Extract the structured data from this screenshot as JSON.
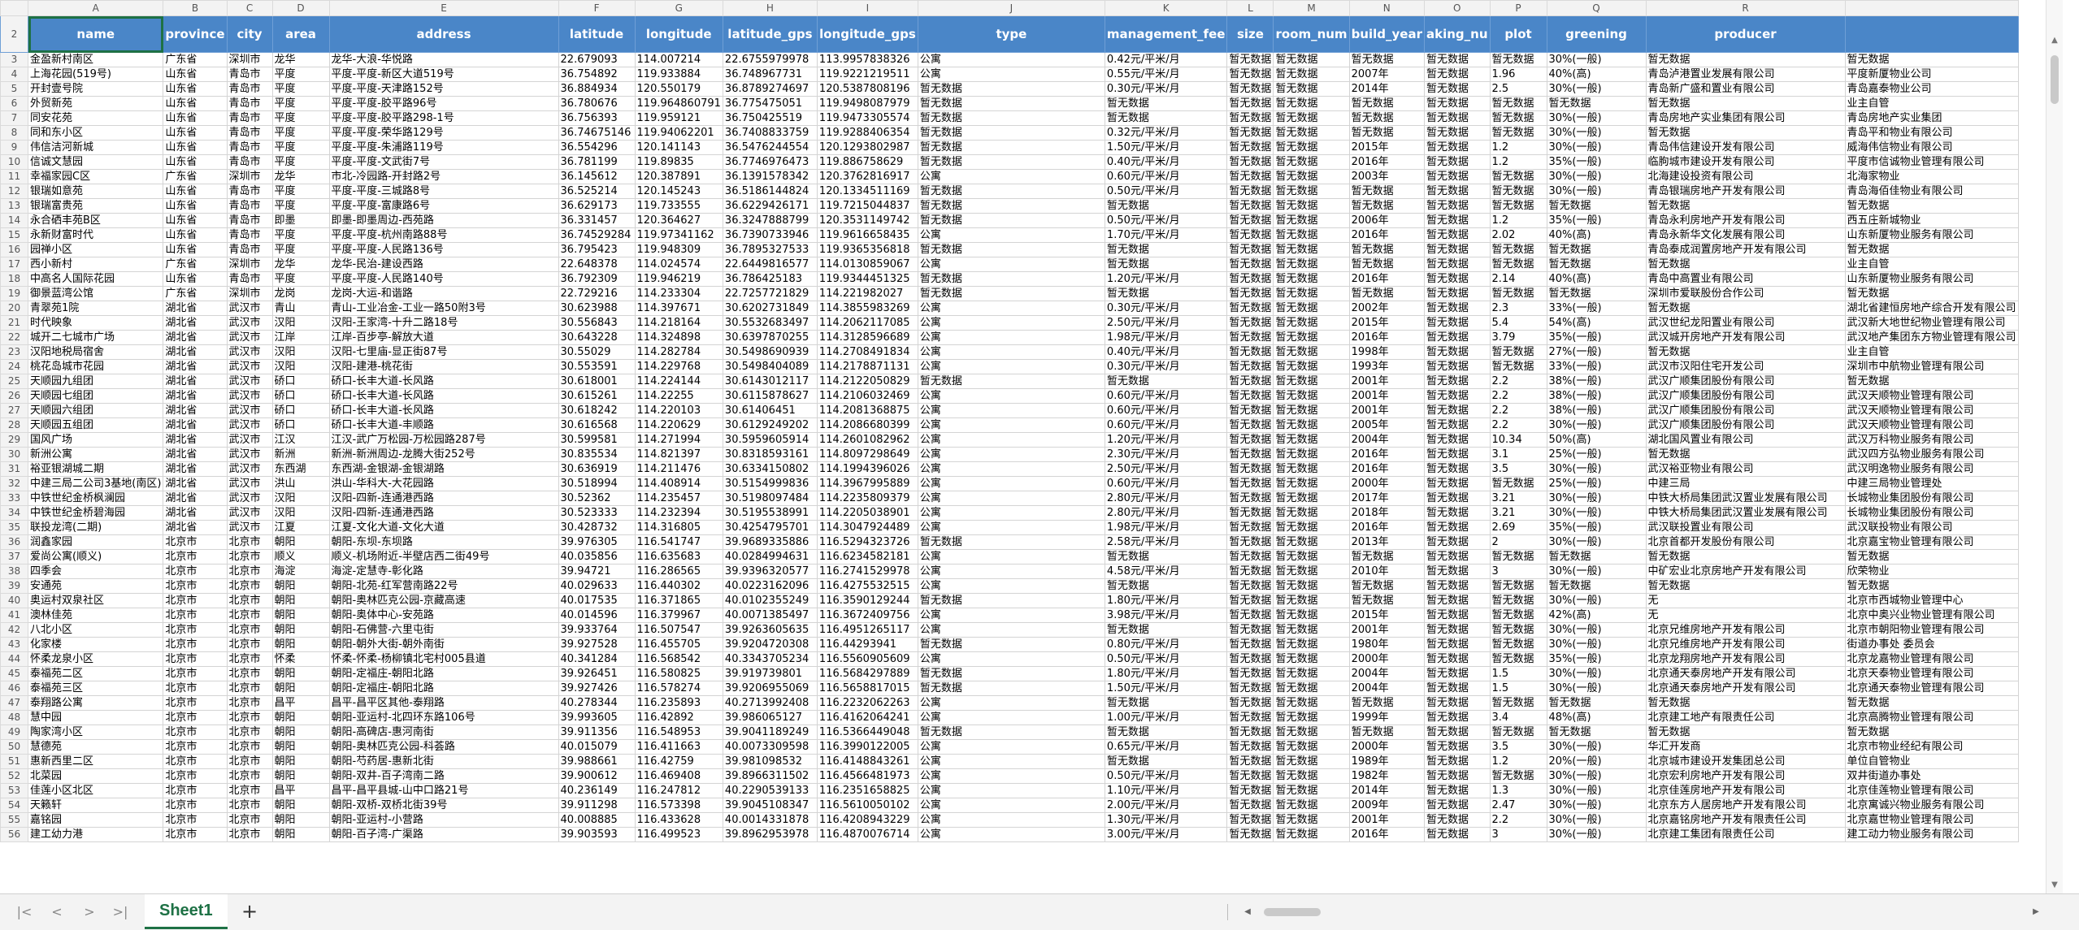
{
  "columns": [
    "A",
    "B",
    "C",
    "D",
    "E",
    "F",
    "G",
    "H",
    "I",
    "J",
    "K",
    "L",
    "M",
    "N",
    "O",
    "P",
    "Q",
    "R"
  ],
  "header_row_number": "2",
  "fields": [
    "name",
    "province",
    "city",
    "area",
    "address",
    "latitude",
    "longitude",
    "latitude_gps",
    "longitude_gps",
    "type",
    "management_fee",
    "size",
    "room_num",
    "build_year",
    "aking_nu",
    "plot",
    "greening",
    "producer"
  ],
  "rows": [
    [
      "3",
      "金盈新村南区",
      "广东省",
      "深圳市",
      "龙华",
      "龙华-大浪-华悦路",
      "22.679093",
      "114.007214",
      "22.6755979978",
      "113.9957838326",
      "公寓",
      "0.42元/平米/月",
      "暂无数据",
      "暂无数据",
      "暂无数据",
      "暂无数据",
      "暂无数据",
      "30%(一般)",
      "暂无数据",
      "暂无数据"
    ],
    [
      "4",
      "上海花园(519号)",
      "山东省",
      "青岛市",
      "平度",
      "平度-平度-新区大道519号",
      "36.754892",
      "119.933884",
      "36.748967731",
      "119.9221219511",
      "公寓",
      "0.55元/平米/月",
      "暂无数据",
      "暂无数据",
      "2007年",
      "暂无数据",
      "1.96",
      "40%(高)",
      "青岛泸港置业发展有限公司",
      "平度新厦物业公司"
    ],
    [
      "5",
      "开封壹号院",
      "山东省",
      "青岛市",
      "平度",
      "平度-平度-天津路152号",
      "36.884934",
      "120.550179",
      "36.8789274697",
      "120.5387808196",
      "暂无数据",
      "0.30元/平米/月",
      "暂无数据",
      "暂无数据",
      "2014年",
      "暂无数据",
      "2.5",
      "30%(一般)",
      "青岛新广盛和置业有限公司",
      "青岛嘉泰物业公司"
    ],
    [
      "6",
      "外贸新苑",
      "山东省",
      "青岛市",
      "平度",
      "平度-平度-胶平路96号",
      "36.780676",
      "119.964860791",
      "36.775475051",
      "119.9498087979",
      "暂无数据",
      "暂无数据",
      "暂无数据",
      "暂无数据",
      "暂无数据",
      "暂无数据",
      "暂无数据",
      "暂无数据",
      "暂无数据",
      "业主自管"
    ],
    [
      "7",
      "同安花苑",
      "山东省",
      "青岛市",
      "平度",
      "平度-平度-胶平路298-1号",
      "36.756393",
      "119.959121",
      "36.750425519",
      "119.9473305574",
      "暂无数据",
      "暂无数据",
      "暂无数据",
      "暂无数据",
      "暂无数据",
      "暂无数据",
      "暂无数据",
      "30%(一般)",
      "青岛房地产实业集团有限公司",
      "青岛房地产实业集团"
    ],
    [
      "8",
      "同和东小区",
      "山东省",
      "青岛市",
      "平度",
      "平度-平度-荣华路129号",
      "36.74675146",
      "119.94062201",
      "36.7408833759",
      "119.9288406354",
      "暂无数据",
      "0.32元/平米/月",
      "暂无数据",
      "暂无数据",
      "暂无数据",
      "暂无数据",
      "暂无数据",
      "30%(一般)",
      "暂无数据",
      "青岛平和物业有限公司"
    ],
    [
      "9",
      "伟信洁河新城",
      "山东省",
      "青岛市",
      "平度",
      "平度-平度-朱浦路119号",
      "36.554296",
      "120.141143",
      "36.5476244554",
      "120.1293802987",
      "暂无数据",
      "1.50元/平米/月",
      "暂无数据",
      "暂无数据",
      "2015年",
      "暂无数据",
      "1.2",
      "30%(一般)",
      "青岛伟信建设开发有限公司",
      "威海伟信物业有限公司"
    ],
    [
      "10",
      "信诚文慧园",
      "山东省",
      "青岛市",
      "平度",
      "平度-平度-文武街7号",
      "36.781199",
      "119.89835",
      "36.7746976473",
      "119.886758629",
      "暂无数据",
      "0.40元/平米/月",
      "暂无数据",
      "暂无数据",
      "2016年",
      "暂无数据",
      "1.2",
      "35%(一般)",
      "临朐城市建设开发有限公司",
      "平度市信诚物业管理有限公司"
    ],
    [
      "11",
      "幸福家园C区",
      "广东省",
      "深圳市",
      "龙华",
      "市北-冷园路-开封路2号",
      "36.145612",
      "120.387891",
      "36.1391578342",
      "120.3762816917",
      "公寓",
      "0.60元/平米/月",
      "暂无数据",
      "暂无数据",
      "2003年",
      "暂无数据",
      "暂无数据",
      "30%(一般)",
      "北海建设投资有限公司",
      "北海家物业"
    ],
    [
      "12",
      "银瑞如意苑",
      "山东省",
      "青岛市",
      "平度",
      "平度-平度-三城路8号",
      "36.525214",
      "120.145243",
      "36.5186144824",
      "120.1334511169",
      "暂无数据",
      "0.50元/平米/月",
      "暂无数据",
      "暂无数据",
      "暂无数据",
      "暂无数据",
      "暂无数据",
      "30%(一般)",
      "青岛银瑞房地产开发有限公司",
      "青岛海佰佳物业有限公司"
    ],
    [
      "13",
      "银瑞富贵苑",
      "山东省",
      "青岛市",
      "平度",
      "平度-平度-富康路6号",
      "36.629173",
      "119.733555",
      "36.6229426171",
      "119.7215044837",
      "暂无数据",
      "暂无数据",
      "暂无数据",
      "暂无数据",
      "暂无数据",
      "暂无数据",
      "暂无数据",
      "暂无数据",
      "暂无数据",
      "暂无数据"
    ],
    [
      "14",
      "永合硒丰苑B区",
      "山东省",
      "青岛市",
      "即墨",
      "即墨-即墨周边-西苑路",
      "36.331457",
      "120.364627",
      "36.3247888799",
      "120.3531149742",
      "暂无数据",
      "0.50元/平米/月",
      "暂无数据",
      "暂无数据",
      "2006年",
      "暂无数据",
      "1.2",
      "35%(一般)",
      "青岛永利房地产开发有限公司",
      "西五庄新城物业"
    ],
    [
      "15",
      "永新财富时代",
      "山东省",
      "青岛市",
      "平度",
      "平度-平度-杭州南路88号",
      "36.74529284",
      "119.97341162",
      "36.7390733946",
      "119.9616658435",
      "公寓",
      "1.70元/平米/月",
      "暂无数据",
      "暂无数据",
      "2016年",
      "暂无数据",
      "2.02",
      "40%(高)",
      "青岛永新华文化发展有限公司",
      "山东新厦物业服务有限公司"
    ],
    [
      "16",
      "园禅小区",
      "山东省",
      "青岛市",
      "平度",
      "平度-平度-人民路136号",
      "36.795423",
      "119.948309",
      "36.7895327533",
      "119.9365356818",
      "暂无数据",
      "暂无数据",
      "暂无数据",
      "暂无数据",
      "暂无数据",
      "暂无数据",
      "暂无数据",
      "暂无数据",
      "青岛泰成润置房地产开发有限公司",
      "暂无数据"
    ],
    [
      "17",
      "西小新村",
      "广东省",
      "深圳市",
      "龙华",
      "龙华-民治-建设西路",
      "22.648378",
      "114.024574",
      "22.6449816577",
      "114.0130859067",
      "公寓",
      "暂无数据",
      "暂无数据",
      "暂无数据",
      "暂无数据",
      "暂无数据",
      "暂无数据",
      "暂无数据",
      "暂无数据",
      "业主自管"
    ],
    [
      "18",
      "中高名人国际花园",
      "山东省",
      "青岛市",
      "平度",
      "平度-平度-人民路140号",
      "36.792309",
      "119.946219",
      "36.786425183",
      "119.9344451325",
      "暂无数据",
      "1.20元/平米/月",
      "暂无数据",
      "暂无数据",
      "2016年",
      "暂无数据",
      "2.14",
      "40%(高)",
      "青岛中高置业有限公司",
      "山东新厦物业服务有限公司"
    ],
    [
      "19",
      "御景蓝湾公馆",
      "广东省",
      "深圳市",
      "龙岗",
      "龙岗-大运-和谐路",
      "22.729216",
      "114.233304",
      "22.7257721829",
      "114.221982027",
      "暂无数据",
      "暂无数据",
      "暂无数据",
      "暂无数据",
      "暂无数据",
      "暂无数据",
      "暂无数据",
      "暂无数据",
      "深圳市爱联股份合作公司",
      "暂无数据"
    ],
    [
      "20",
      "青翠苑1院",
      "湖北省",
      "武汉市",
      "青山",
      "青山-工业冶金-工业一路50附3号",
      "30.623988",
      "114.397671",
      "30.6202731849",
      "114.3855983269",
      "公寓",
      "0.30元/平米/月",
      "暂无数据",
      "暂无数据",
      "2002年",
      "暂无数据",
      "2.3",
      "33%(一般)",
      "暂无数据",
      "湖北省建恒房地产综合开发有限公司"
    ],
    [
      "21",
      "时代映象",
      "湖北省",
      "武汉市",
      "汉阳",
      "汉阳-王家湾-十升二路18号",
      "30.556843",
      "114.218164",
      "30.5532683497",
      "114.2062117085",
      "公寓",
      "2.50元/平米/月",
      "暂无数据",
      "暂无数据",
      "2015年",
      "暂无数据",
      "5.4",
      "54%(高)",
      "武汉世纪龙阳置业有限公司",
      "武汉新大地世纪物业管理有限公司"
    ],
    [
      "22",
      "城开二七城市广场",
      "湖北省",
      "武汉市",
      "江岸",
      "江岸-百步亭-解放大道",
      "30.643228",
      "114.324898",
      "30.6397870255",
      "114.3128596689",
      "公寓",
      "1.98元/平米/月",
      "暂无数据",
      "暂无数据",
      "2016年",
      "暂无数据",
      "3.79",
      "35%(一般)",
      "武汉城开房地产开发有限公司",
      "武汉地产集团东方物业管理有限公司"
    ],
    [
      "23",
      "汉阳地税局宿舍",
      "湖北省",
      "武汉市",
      "汉阳",
      "汉阳-七里庙-显正街87号",
      "30.55029",
      "114.282784",
      "30.5498690939",
      "114.2708491834",
      "公寓",
      "0.40元/平米/月",
      "暂无数据",
      "暂无数据",
      "1998年",
      "暂无数据",
      "暂无数据",
      "27%(一般)",
      "暂无数据",
      "业主自管"
    ],
    [
      "24",
      "桃花岛城市花园",
      "湖北省",
      "武汉市",
      "汉阳",
      "汉阳-建港-桃花街",
      "30.553591",
      "114.229768",
      "30.5498404089",
      "114.2178871131",
      "公寓",
      "0.30元/平米/月",
      "暂无数据",
      "暂无数据",
      "1993年",
      "暂无数据",
      "暂无数据",
      "33%(一般)",
      "武汉市汉阳住宅开发公司",
      "深圳市中航物业管理有限公司"
    ],
    [
      "25",
      "天顺园九组团",
      "湖北省",
      "武汉市",
      "硚口",
      "硚口-长丰大道-长风路",
      "30.618001",
      "114.224144",
      "30.6143012117",
      "114.2122050829",
      "暂无数据",
      "暂无数据",
      "暂无数据",
      "暂无数据",
      "2001年",
      "暂无数据",
      "2.2",
      "38%(一般)",
      "武汉广顺集团股份有限公司",
      "暂无数据"
    ],
    [
      "26",
      "天顺园七组团",
      "湖北省",
      "武汉市",
      "硚口",
      "硚口-长丰大道-长风路",
      "30.615261",
      "114.22255",
      "30.6115878627",
      "114.2106032469",
      "公寓",
      "0.60元/平米/月",
      "暂无数据",
      "暂无数据",
      "2001年",
      "暂无数据",
      "2.2",
      "38%(一般)",
      "武汉广顺集团股份有限公司",
      "武汉天顺物业管理有限公司"
    ],
    [
      "27",
      "天顺园六组团",
      "湖北省",
      "武汉市",
      "硚口",
      "硚口-长丰大道-长风路",
      "30.618242",
      "114.220103",
      "30.61406451",
      "114.2081368875",
      "公寓",
      "0.60元/平米/月",
      "暂无数据",
      "暂无数据",
      "2001年",
      "暂无数据",
      "2.2",
      "38%(一般)",
      "武汉广顺集团股份有限公司",
      "武汉天顺物业管理有限公司"
    ],
    [
      "28",
      "天顺园五组团",
      "湖北省",
      "武汉市",
      "硚口",
      "硚口-长丰大道-丰顺路",
      "30.616568",
      "114.220629",
      "30.6129249202",
      "114.2086680399",
      "公寓",
      "0.60元/平米/月",
      "暂无数据",
      "暂无数据",
      "2005年",
      "暂无数据",
      "2.2",
      "30%(一般)",
      "武汉广顺集团股份有限公司",
      "武汉天顺物业管理有限公司"
    ],
    [
      "29",
      "国风广场",
      "湖北省",
      "武汉市",
      "江汉",
      "江汉-武广万松园-万松园路287号",
      "30.599581",
      "114.271994",
      "30.5959605914",
      "114.2601082962",
      "公寓",
      "1.20元/平米/月",
      "暂无数据",
      "暂无数据",
      "2004年",
      "暂无数据",
      "10.34",
      "50%(高)",
      "湖北国风置业有限公司",
      "武汉万科物业服务有限公司"
    ],
    [
      "30",
      "新洲公寓",
      "湖北省",
      "武汉市",
      "新洲",
      "新洲-新洲周边-龙腾大街252号",
      "30.835534",
      "114.821397",
      "30.8318593161",
      "114.8097298649",
      "公寓",
      "2.30元/平米/月",
      "暂无数据",
      "暂无数据",
      "2016年",
      "暂无数据",
      "3.1",
      "25%(一般)",
      "暂无数据",
      "武汉四方弘物业服务有限公司"
    ],
    [
      "31",
      "裕亚银湖城二期",
      "湖北省",
      "武汉市",
      "东西湖",
      "东西湖-金银湖-金银湖路",
      "30.636919",
      "114.211476",
      "30.6334150802",
      "114.1994396026",
      "公寓",
      "2.50元/平米/月",
      "暂无数据",
      "暂无数据",
      "2016年",
      "暂无数据",
      "3.5",
      "30%(一般)",
      "武汉裕亚物业有限公司",
      "武汉明逸物业服务有限公司"
    ],
    [
      "32",
      "中建三局二公司3基地(南区)",
      "湖北省",
      "武汉市",
      "洪山",
      "洪山-华科大-大花园路",
      "30.518994",
      "114.408914",
      "30.5154999836",
      "114.3967995889",
      "公寓",
      "0.60元/平米/月",
      "暂无数据",
      "暂无数据",
      "2000年",
      "暂无数据",
      "暂无数据",
      "25%(一般)",
      "中建三局",
      "中建三局物业管理处"
    ],
    [
      "33",
      "中铁世纪金桥枫澜园",
      "湖北省",
      "武汉市",
      "汉阳",
      "汉阳-四新-连通港西路",
      "30.52362",
      "114.235457",
      "30.5198097484",
      "114.2235809379",
      "公寓",
      "2.80元/平米/月",
      "暂无数据",
      "暂无数据",
      "2017年",
      "暂无数据",
      "3.21",
      "30%(一般)",
      "中铁大桥局集团武汉置业发展有限公司",
      "长城物业集团股份有限公司"
    ],
    [
      "34",
      "中铁世纪金桥碧海园",
      "湖北省",
      "武汉市",
      "汉阳",
      "汉阳-四新-连通港西路",
      "30.523333",
      "114.232394",
      "30.5195538991",
      "114.2205038901",
      "公寓",
      "2.80元/平米/月",
      "暂无数据",
      "暂无数据",
      "2018年",
      "暂无数据",
      "3.21",
      "30%(一般)",
      "中铁大桥局集团武汉置业发展有限公司",
      "长城物业集团股份有限公司"
    ],
    [
      "35",
      "联投龙湾(二期)",
      "湖北省",
      "武汉市",
      "江夏",
      "江夏-文化大道-文化大道",
      "30.428732",
      "114.316805",
      "30.4254795701",
      "114.3047924489",
      "公寓",
      "1.98元/平米/月",
      "暂无数据",
      "暂无数据",
      "2016年",
      "暂无数据",
      "2.69",
      "35%(一般)",
      "武汉联投置业有限公司",
      "武汉联投物业有限公司"
    ],
    [
      "36",
      "润鑫家园",
      "北京市",
      "北京市",
      "朝阳",
      "朝阳-东坝-东坝路",
      "39.976305",
      "116.541747",
      "39.9689335886",
      "116.5294323726",
      "暂无数据",
      "2.58元/平米/月",
      "暂无数据",
      "暂无数据",
      "2013年",
      "暂无数据",
      "2",
      "30%(一般)",
      "北京首都开发股份有限公司",
      "北京嘉宝物业管理有限公司"
    ],
    [
      "37",
      "爱尚公寓(顺义)",
      "北京市",
      "北京市",
      "顺义",
      "顺义-机场附近-半壁店西二街49号",
      "40.035856",
      "116.635683",
      "40.0284994631",
      "116.6234582181",
      "公寓",
      "暂无数据",
      "暂无数据",
      "暂无数据",
      "暂无数据",
      "暂无数据",
      "暂无数据",
      "暂无数据",
      "暂无数据",
      "暂无数据"
    ],
    [
      "38",
      "四季会",
      "北京市",
      "北京市",
      "海淀",
      "海淀-定慧寺-彰化路",
      "39.94721",
      "116.286565",
      "39.9396320577",
      "116.2741529978",
      "公寓",
      "4.58元/平米/月",
      "暂无数据",
      "暂无数据",
      "2010年",
      "暂无数据",
      "3",
      "30%(一般)",
      "中矿宏业北京房地产开发有限公司",
      "欣荣物业"
    ],
    [
      "39",
      "安通苑",
      "北京市",
      "北京市",
      "朝阳",
      "朝阳-北苑-红军营南路22号",
      "40.029633",
      "116.440302",
      "40.0223162096",
      "116.4275532515",
      "公寓",
      "暂无数据",
      "暂无数据",
      "暂无数据",
      "暂无数据",
      "暂无数据",
      "暂无数据",
      "暂无数据",
      "暂无数据",
      "暂无数据"
    ],
    [
      "40",
      "奥运村双泉社区",
      "北京市",
      "北京市",
      "朝阳",
      "朝阳-奥林匹克公园-京藏高速",
      "40.017535",
      "116.371865",
      "40.0102355249",
      "116.3590129244",
      "暂无数据",
      "1.80元/平米/月",
      "暂无数据",
      "暂无数据",
      "暂无数据",
      "暂无数据",
      "暂无数据",
      "30%(一般)",
      "无",
      "北京市西城物业管理中心"
    ],
    [
      "41",
      "澳林佳苑",
      "北京市",
      "北京市",
      "朝阳",
      "朝阳-奥体中心-安苑路",
      "40.014596",
      "116.379967",
      "40.0071385497",
      "116.3672409756",
      "公寓",
      "3.98元/平米/月",
      "暂无数据",
      "暂无数据",
      "2015年",
      "暂无数据",
      "暂无数据",
      "42%(高)",
      "无",
      "北京中奥兴业物业管理有限公司"
    ],
    [
      "42",
      "八北小区",
      "北京市",
      "北京市",
      "朝阳",
      "朝阳-石佛营-六里屯街",
      "39.933764",
      "116.507547",
      "39.9263605635",
      "116.4951265117",
      "公寓",
      "暂无数据",
      "暂无数据",
      "暂无数据",
      "2001年",
      "暂无数据",
      "暂无数据",
      "30%(一般)",
      "北京兄维房地产开发有限公司",
      "北京市朝阳物业管理有限公司"
    ],
    [
      "43",
      "化家楼",
      "北京市",
      "北京市",
      "朝阳",
      "朝阳-朝外大街-朝外南街",
      "39.927528",
      "116.455705",
      "39.9204720308",
      "116.44293941",
      "暂无数据",
      "0.80元/平米/月",
      "暂无数据",
      "暂无数据",
      "1980年",
      "暂无数据",
      "暂无数据",
      "30%(一般)",
      "北京兄维房地产开发有限公司",
      "街道办事处 委员会"
    ],
    [
      "44",
      "怀柔龙泉小区",
      "北京市",
      "北京市",
      "怀柔",
      "怀柔-怀柔-杨柳镇北宅村005县道",
      "40.341284",
      "116.568542",
      "40.3343705234",
      "116.5560905609",
      "公寓",
      "0.50元/平米/月",
      "暂无数据",
      "暂无数据",
      "2000年",
      "暂无数据",
      "暂无数据",
      "35%(一般)",
      "北京龙翔房地产开发有限公司",
      "北京龙嘉物业管理有限公司"
    ],
    [
      "45",
      "泰福苑二区",
      "北京市",
      "北京市",
      "朝阳",
      "朝阳-定福庄-朝阳北路",
      "39.926451",
      "116.580825",
      "39.919739801",
      "116.5684297889",
      "暂无数据",
      "1.80元/平米/月",
      "暂无数据",
      "暂无数据",
      "2004年",
      "暂无数据",
      "1.5",
      "30%(一般)",
      "北京通天泰房地产开发有限公司",
      "北京天泰物业管理有限公司"
    ],
    [
      "46",
      "泰福苑三区",
      "北京市",
      "北京市",
      "朝阳",
      "朝阳-定福庄-朝阳北路",
      "39.927426",
      "116.578274",
      "39.9206955069",
      "116.5658817015",
      "暂无数据",
      "1.50元/平米/月",
      "暂无数据",
      "暂无数据",
      "2004年",
      "暂无数据",
      "1.5",
      "30%(一般)",
      "北京通天泰房地产开发有限公司",
      "北京通天泰物业管理有限公司"
    ],
    [
      "47",
      "泰翔路公寓",
      "北京市",
      "北京市",
      "昌平",
      "昌平-昌平区其他-泰翔路",
      "40.278344",
      "116.235893",
      "40.2713992408",
      "116.2232062263",
      "公寓",
      "暂无数据",
      "暂无数据",
      "暂无数据",
      "暂无数据",
      "暂无数据",
      "暂无数据",
      "暂无数据",
      "暂无数据",
      "暂无数据"
    ],
    [
      "48",
      "慧中园",
      "北京市",
      "北京市",
      "朝阳",
      "朝阳-亚运村-北四环东路106号",
      "39.993605",
      "116.42892",
      "39.986065127",
      "116.4162064241",
      "公寓",
      "1.00元/平米/月",
      "暂无数据",
      "暂无数据",
      "1999年",
      "暂无数据",
      "3.4",
      "48%(高)",
      "北京建工地产有限责任公司",
      "北京高腾物业管理有限公司"
    ],
    [
      "49",
      "陶家湾小区",
      "北京市",
      "北京市",
      "朝阳",
      "朝阳-高碑店-惠河南街",
      "39.911356",
      "116.548953",
      "39.9041189249",
      "116.5366449048",
      "暂无数据",
      "暂无数据",
      "暂无数据",
      "暂无数据",
      "暂无数据",
      "暂无数据",
      "暂无数据",
      "暂无数据",
      "暂无数据",
      "暂无数据"
    ],
    [
      "50",
      "慧德苑",
      "北京市",
      "北京市",
      "朝阳",
      "朝阳-奥林匹克公园-科荟路",
      "40.015079",
      "116.411663",
      "40.0073309598",
      "116.3990122005",
      "公寓",
      "0.65元/平米/月",
      "暂无数据",
      "暂无数据",
      "2000年",
      "暂无数据",
      "3.5",
      "30%(一般)",
      "华汇开发商",
      "北京市物业经纪有限公司"
    ],
    [
      "51",
      "惠新西里二区",
      "北京市",
      "北京市",
      "朝阳",
      "朝阳-芍药居-惠新北街",
      "39.988661",
      "116.42759",
      "39.981098532",
      "116.4148843261",
      "公寓",
      "暂无数据",
      "暂无数据",
      "暂无数据",
      "1989年",
      "暂无数据",
      "1.2",
      "20%(一般)",
      "北京城市建设开发集团总公司",
      "单位自管物业"
    ],
    [
      "52",
      "北菜园",
      "北京市",
      "北京市",
      "朝阳",
      "朝阳-双井-百子湾南二路",
      "39.900612",
      "116.469408",
      "39.8966311502",
      "116.4566481973",
      "公寓",
      "0.50元/平米/月",
      "暂无数据",
      "暂无数据",
      "1982年",
      "暂无数据",
      "暂无数据",
      "30%(一般)",
      "北京宏利房地产开发有限公司",
      "双井街道办事处"
    ],
    [
      "53",
      "佳莲小区北区",
      "北京市",
      "北京市",
      "昌平",
      "昌平-昌平县城-山中口路21号",
      "40.236149",
      "116.247812",
      "40.2290539133",
      "116.2351658825",
      "公寓",
      "1.10元/平米/月",
      "暂无数据",
      "暂无数据",
      "2014年",
      "暂无数据",
      "1.3",
      "30%(一般)",
      "北京佳莲房地产开发有限公司",
      "北京佳莲物业管理有限公司"
    ],
    [
      "54",
      "天籁轩",
      "北京市",
      "北京市",
      "朝阳",
      "朝阳-双桥-双桥北街39号",
      "39.911298",
      "116.573398",
      "39.9045108347",
      "116.5610050102",
      "公寓",
      "2.00元/平米/月",
      "暂无数据",
      "暂无数据",
      "2009年",
      "暂无数据",
      "2.47",
      "30%(一般)",
      "北京东方人居房地产开发有限公司",
      "北京寓诚兴物业服务有限公司"
    ],
    [
      "55",
      "嘉铭园",
      "北京市",
      "北京市",
      "朝阳",
      "朝阳-亚运村-小营路",
      "40.008885",
      "116.433628",
      "40.0014331878",
      "116.4208943229",
      "公寓",
      "1.30元/平米/月",
      "暂无数据",
      "暂无数据",
      "2001年",
      "暂无数据",
      "2.2",
      "30%(一般)",
      "北京嘉铭房地产开发有限责任公司",
      "北京嘉世物业管理有限公司"
    ],
    [
      "56",
      "建工幼力港",
      "北京市",
      "北京市",
      "朝阳",
      "朝阳-百子湾-广渠路",
      "39.903593",
      "116.499523",
      "39.8962953978",
      "116.4870076714",
      "公寓",
      "3.00元/平米/月",
      "暂无数据",
      "暂无数据",
      "2016年",
      "暂无数据",
      "3",
      "30%(一般)",
      "北京建工集团有限责任公司",
      "建工动力物业服务有限公司"
    ]
  ],
  "ui": {
    "sheet_tab": "Sheet1",
    "add_sheet": "+",
    "nav_first": "|<",
    "nav_prev": "<",
    "nav_next": ">",
    "nav_last": ">|"
  }
}
